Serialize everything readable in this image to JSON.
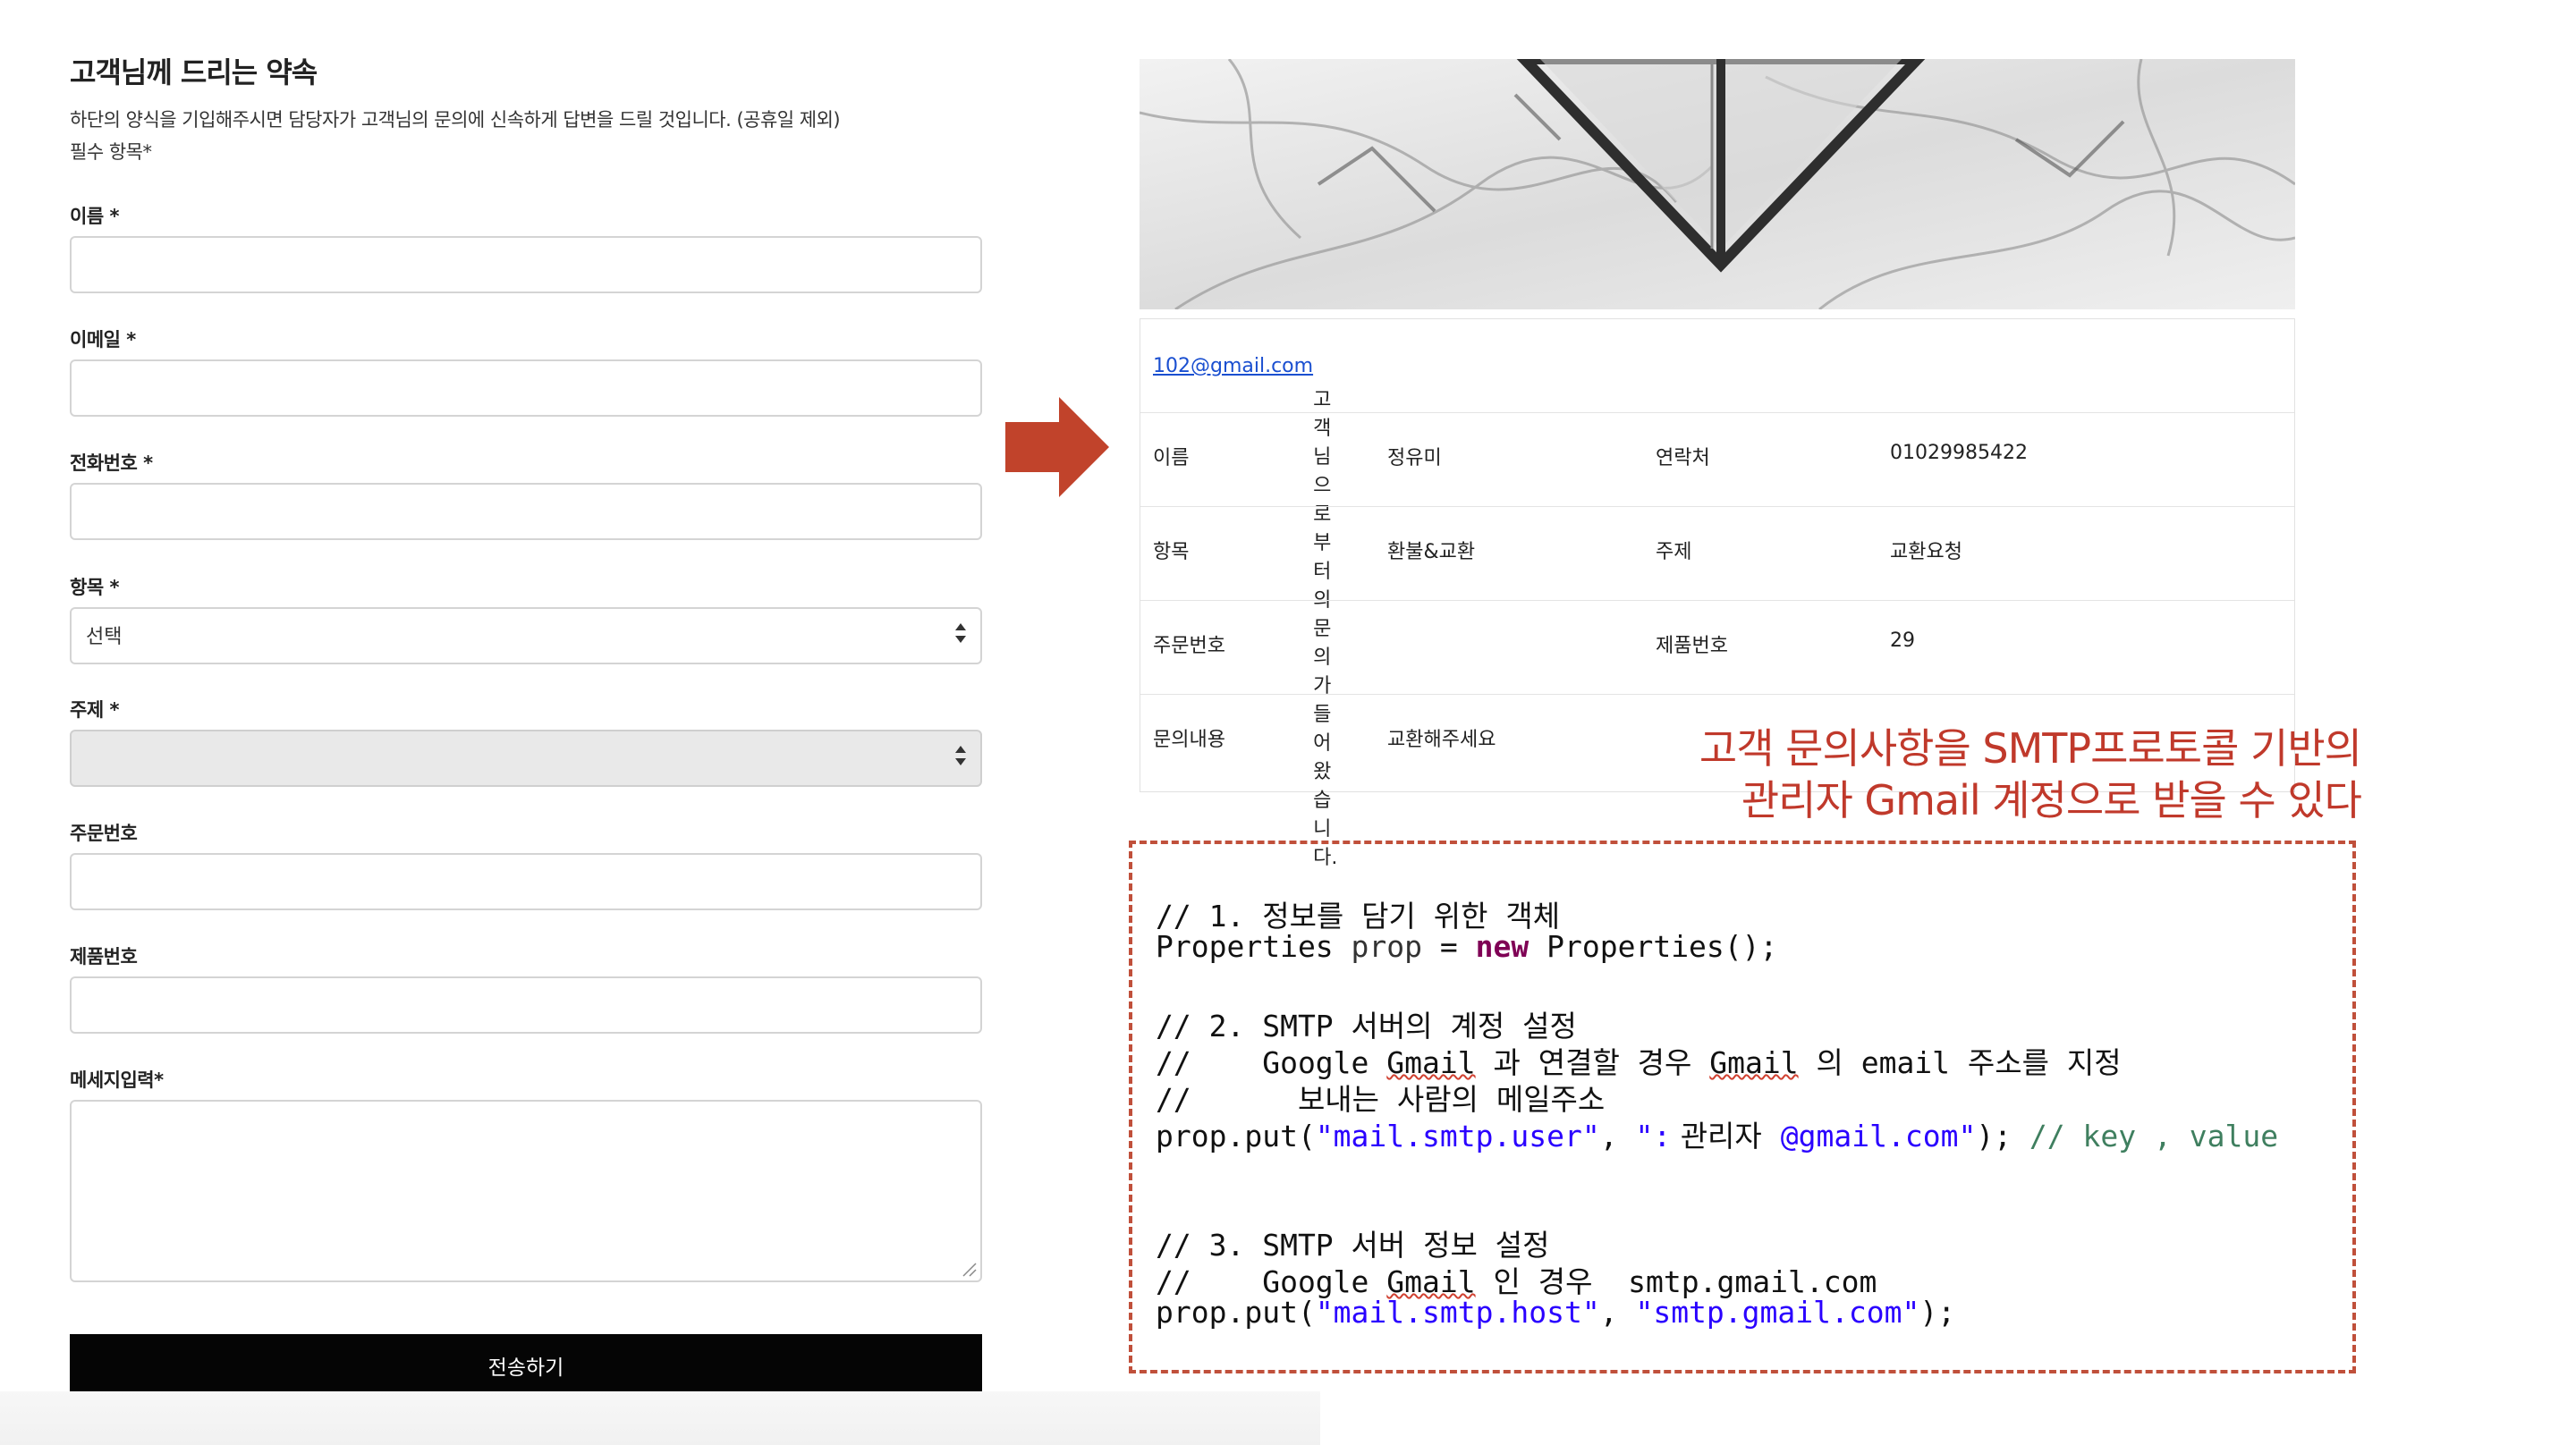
{
  "form": {
    "title": "고객님께 드리는 약속",
    "desc_line1": "하단의 양식을 기입해주시면 담당자가 고객님의 문의에 신속하게 답변을 드릴 것입니다. (공휴일 제외)",
    "desc_line2": "필수 항목*",
    "fields": {
      "name": {
        "label": "이름 *",
        "value": ""
      },
      "email": {
        "label": "이메일 *",
        "value": ""
      },
      "phone": {
        "label": "전화번호 *",
        "value": ""
      },
      "category": {
        "label": "항목 *",
        "value": "선택"
      },
      "subject": {
        "label": "주제 *",
        "value": ""
      },
      "order_no": {
        "label": "주문번호",
        "value": ""
      },
      "product_no": {
        "label": "제품번호",
        "value": ""
      },
      "message": {
        "label": "메세지입력*",
        "value": ""
      }
    },
    "submit_label": "전송하기"
  },
  "mail": {
    "sender_email": "102@gmail.com",
    "intro_text": "고객님으로부터의 문의가 들어왔습니다.",
    "rows": [
      {
        "k1": "이름",
        "v1": "정유미",
        "k2": "연락처",
        "v2": "01029985422"
      },
      {
        "k1": "항목",
        "v1": "환불&교환",
        "k2": "주제",
        "v2": "교환요청"
      },
      {
        "k1": "주문번호",
        "v1": "",
        "k2": "제품번호",
        "v2": "29"
      },
      {
        "k1": "문의내용",
        "v1": "교환해주세요",
        "k2": "",
        "v2": ""
      }
    ]
  },
  "caption": {
    "line1": "고객 문의사항을 SMTP프로토콜 기반의",
    "line2": "관리자 Gmail 계정으로 받을 수 있다"
  },
  "code": {
    "c1": "// 1. 정보를 담기 위한 객체",
    "l2_a": "Properties ",
    "l2_b": "prop",
    "l2_c": " = ",
    "l2_kw": "new",
    "l2_d": " Properties();",
    "c3": "// 2. SMTP 서버의 계정 설정",
    "c4_a": "//    Google ",
    "c4_g1": "Gmail",
    "c4_b": " 과 연결할 경우 ",
    "c4_g2": "Gmail",
    "c4_c": " 의 email 주소를 지정",
    "c5": "//      보내는 사람의 메일주소",
    "l6_a": "prop.put(",
    "l6_s1": "\"mail.smtp.user\"",
    "l6_b": ", ",
    "l6_s2": "\":",
    "l6_admin": " 관리자  ",
    "l6_s3": "@gmail.com\"",
    "l6_c": "); ",
    "l6_cm": "// key , value",
    "c7": "// 3. SMTP 서버 정보 설정",
    "c8_a": "//    Google ",
    "c8_g": "Gmail",
    "c8_b": " 인 경우  smtp.gmail.com",
    "l9_a": "prop.put(",
    "l9_s1": "\"mail.smtp.host\"",
    "l9_b": ", ",
    "l9_s2": "\"smtp.gmail.com\"",
    "l9_c": ");"
  },
  "colors": {
    "accent_red": "#c0392b",
    "submit_bg": "#050505"
  }
}
